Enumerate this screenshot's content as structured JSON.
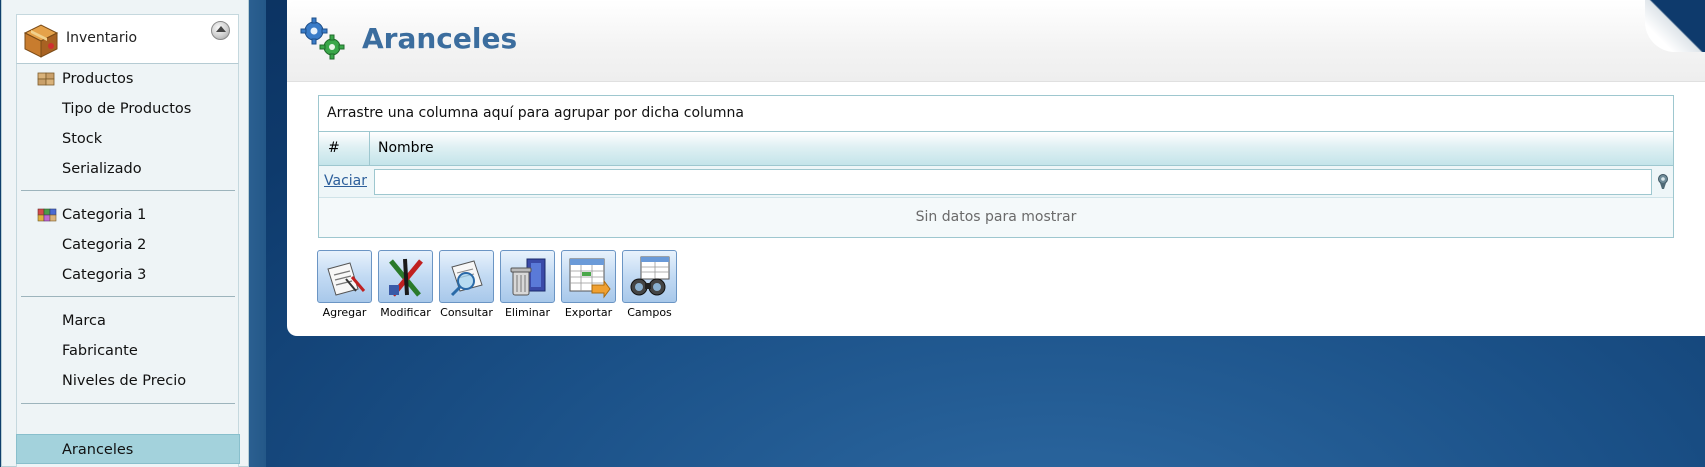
{
  "sidebar": {
    "header_title": "Inventario",
    "groups": [
      {
        "items": [
          {
            "label": "Productos",
            "icon": "boxes-icon"
          },
          {
            "label": "Tipo de Productos"
          },
          {
            "label": "Stock"
          },
          {
            "label": "Serializado"
          }
        ]
      },
      {
        "items": [
          {
            "label": "Categoria 1",
            "icon": "colored-boxes-icon"
          },
          {
            "label": "Categoria 2"
          },
          {
            "label": "Categoria 3"
          }
        ]
      },
      {
        "items": [
          {
            "label": "Marca"
          },
          {
            "label": "Fabricante"
          },
          {
            "label": "Niveles de Precio"
          }
        ]
      },
      {
        "items": [
          {
            "label": "Aranceles",
            "selected": true
          }
        ]
      }
    ]
  },
  "page": {
    "title": "Aranceles"
  },
  "grid": {
    "group_panel_text": "Arrastre una columna aquí para agrupar por dicha columna",
    "columns": [
      "#",
      "Nombre"
    ],
    "filter_clear_label": "Vaciar",
    "filter_value": "",
    "empty_text": "Sin datos para mostrar"
  },
  "toolbar": {
    "buttons": [
      {
        "label": "Agregar",
        "icon": "add-document-icon"
      },
      {
        "label": "Modificar",
        "icon": "edit-pencils-icon"
      },
      {
        "label": "Consultar",
        "icon": "search-document-icon"
      },
      {
        "label": "Eliminar",
        "icon": "trash-icon"
      },
      {
        "label": "Exportar",
        "icon": "export-spreadsheet-icon"
      },
      {
        "label": "Campos",
        "icon": "binoculars-icon"
      }
    ]
  },
  "colors": {
    "accent_title": "#3b6d9e",
    "selected_item_bg": "#a3d2dc",
    "grid_border": "#9ec7cf",
    "background_blue": "#0e3a6c"
  }
}
